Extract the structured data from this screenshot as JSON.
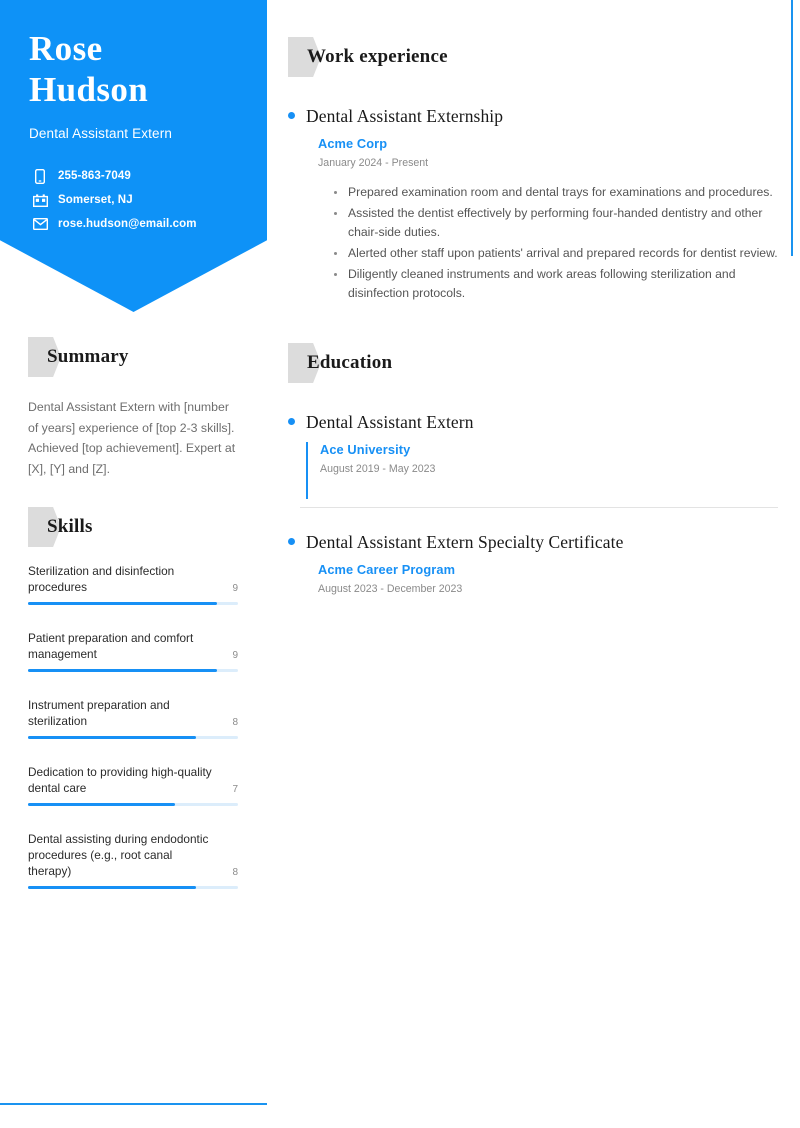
{
  "theme": {
    "accent": "#0E92F7",
    "accent_bar": "#1790F5",
    "tag_gray": "#DCDCDC",
    "body_gray": "#6E6E6E"
  },
  "header": {
    "first_name": "Rose",
    "last_name": "Hudson",
    "job_title": "Dental Assistant Extern",
    "contacts": [
      {
        "icon": "phone-icon",
        "value": "255-863-7049"
      },
      {
        "icon": "location-building-icon",
        "value": "Somerset, NJ"
      },
      {
        "icon": "envelope-icon",
        "value": "rose.hudson@email.com"
      }
    ]
  },
  "summary": {
    "heading": "Summary",
    "text": "Dental Assistant Extern with [number of years] experience of [top 2-3 skills]. Achieved [top achievement]. Expert at [X], [Y] and [Z]."
  },
  "skills": {
    "heading": "Skills",
    "items": [
      {
        "name": "Sterilization and disinfection procedures",
        "score": "9",
        "percent": 90
      },
      {
        "name": "Patient preparation and comfort management",
        "score": "9",
        "percent": 90
      },
      {
        "name": "Instrument preparation and sterilization",
        "score": "8",
        "percent": 80
      },
      {
        "name": "Dedication to providing high-quality dental care",
        "score": "7",
        "percent": 70
      },
      {
        "name": "Dental assisting during endodontic procedures (e.g., root canal therapy)",
        "score": "8",
        "percent": 80
      }
    ]
  },
  "work_experience": {
    "heading": "Work experience",
    "entries": [
      {
        "title": "Dental Assistant Externship",
        "organization": "Acme Corp",
        "date": "January 2024 - Present",
        "bullets": [
          "Prepared examination room and dental trays for examinations and procedures.",
          "Assisted the dentist effectively by performing four-handed dentistry and other chair-side duties.",
          "Alerted other staff upon patients' arrival and prepared records for dentist review.",
          "Diligently cleaned instruments and work areas following sterilization and disinfection protocols."
        ]
      }
    ]
  },
  "education": {
    "heading": "Education",
    "entries": [
      {
        "title": "Dental Assistant Extern",
        "organization": "Ace University",
        "date": "August 2019 - May 2023"
      },
      {
        "title": "Dental Assistant Extern Specialty Certificate",
        "organization": "Acme Career Program",
        "date": "August 2023 - December 2023"
      }
    ]
  }
}
